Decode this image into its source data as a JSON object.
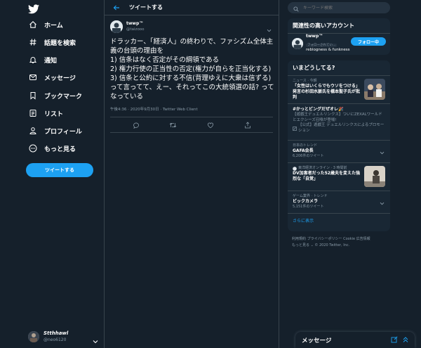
{
  "colors": {
    "background": "#15202b",
    "accent": "#1da1f2",
    "muted": "#8899a6",
    "border": "#38444d",
    "card": "#192734"
  },
  "nav": {
    "items": [
      {
        "label": "ホーム",
        "icon": "home-icon"
      },
      {
        "label": "話題を検索",
        "icon": "hashtag-icon"
      },
      {
        "label": "通知",
        "icon": "bell-icon"
      },
      {
        "label": "メッセージ",
        "icon": "mail-icon"
      },
      {
        "label": "ブックマーク",
        "icon": "bookmark-icon"
      },
      {
        "label": "リスト",
        "icon": "list-icon"
      },
      {
        "label": "プロフィール",
        "icon": "person-icon"
      },
      {
        "label": "もっと見る",
        "icon": "more-circle-icon"
      }
    ],
    "tweet_button": "ツイートする",
    "account": {
      "name": "Stthhawl",
      "handle": "@neo6120"
    }
  },
  "header": {
    "title": "ツイートする"
  },
  "tweet": {
    "name": "twwp™",
    "handle": "@taizooo",
    "text": "ドラッカー、「経済人」の終わりで、ファシズム全体主義の台頭の理由を\n1) 信条はなく否定がその綱領である\n2) 権力行使の正当性の否定(権力が自らを正当化する)\n3) 信条と公約に対する不信(背理ゆえに大衆は信ずる)\nって言ってて、えー、それってこの大統領選の話? ってなっている",
    "meta": "午後4:36 · 2020年9月30日 · Twitter Web Client"
  },
  "search": {
    "placeholder": "キーワード検索"
  },
  "relevant": {
    "title": "関連性の高いアカウント",
    "name": "twwp™",
    "badge": "フォローされてい…",
    "bio": "reblogness & funkness",
    "follow_label": "フォロー中"
  },
  "trends": {
    "title": "いまどうしてる?",
    "items": [
      {
        "category": "ニュース · 今朝",
        "title": "「女性はいくらでもウソをつける」発言の杉田水脈氏を橋本聖子氏が批判"
      },
      {
        "title": "#かっとビングだぜオレ🎉",
        "body": "【遊戯王デュエルリンクス】ついにZEXALワールドとエクシーズ召喚が登場!",
        "promo": "【公式】遊戯王 デュエルリンクスによるプロモーション"
      },
      {
        "category": "日本のトレンド",
        "title": "GAFA会長",
        "count": "6,206件のツイート"
      },
      {
        "source": "東洋経済オンライン · 3 時間前",
        "title": "DV加害者だった52歳夫を変えた強烈な「自覚」"
      },
      {
        "category": "ゲーム業界 · トレンド",
        "title": "ビックカメラ",
        "count": "5,151件のツイート"
      }
    ],
    "show_more": "さらに表示"
  },
  "footer": {
    "line1": "利用規約 プライバシーポリシー Cookie 広告情報",
    "line2": "もっと見る ⌄ © 2020 Twitter, Inc."
  },
  "messages": {
    "title": "メッセージ"
  }
}
